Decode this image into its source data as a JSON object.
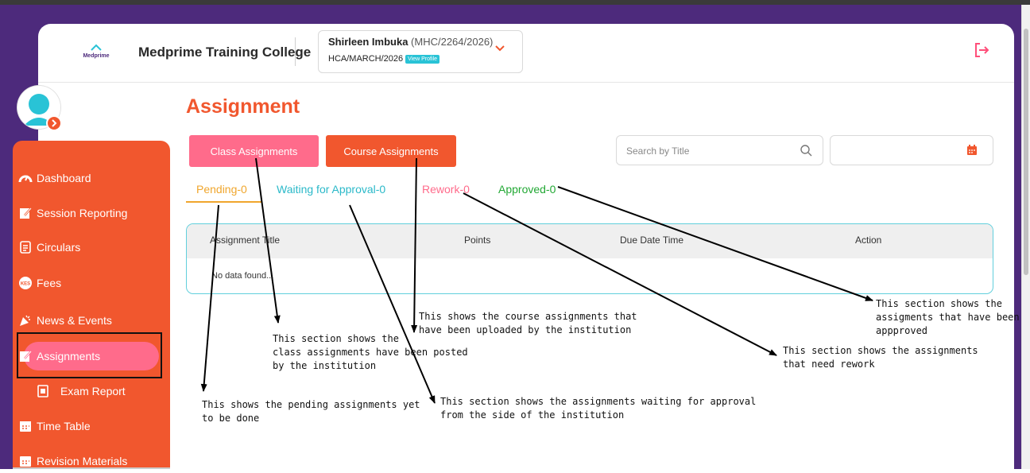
{
  "header": {
    "college_name": "Medprime Training College",
    "logo_text": "Medprime",
    "student_name": "Shirleen Imbuka",
    "student_id": "(MHC/2264/2026)",
    "class_code": "HCA/MARCH/2026",
    "view_profile_label": "View Profile"
  },
  "sidebar": {
    "items": [
      {
        "label": "Dashboard",
        "icon": "dashboard-icon"
      },
      {
        "label": "Session Reporting",
        "icon": "edit-icon"
      },
      {
        "label": "Circulars",
        "icon": "circular-icon"
      },
      {
        "label": "Fees",
        "icon": "fees-icon"
      },
      {
        "label": "News & Events",
        "icon": "party-icon"
      },
      {
        "label": "Assignments",
        "icon": "edit-icon"
      },
      {
        "label": "Exam Report",
        "icon": "report-icon"
      },
      {
        "label": "Time Table",
        "icon": "calendar-icon"
      },
      {
        "label": "Revision Materials",
        "icon": "calendar-icon"
      }
    ],
    "fees_badge": "KES"
  },
  "main": {
    "title": "Assignment",
    "buttons": {
      "class": "Class Assignments",
      "course": "Course Assignments"
    },
    "search_placeholder": "Search by Title",
    "tabs": {
      "pending": "Pending-0",
      "waiting": "Waiting for Approval-0",
      "rework": "Rework-0",
      "approved": "Approved-0"
    },
    "table": {
      "columns": [
        "Assignment Title",
        "Points",
        "Due Date Time",
        "Action"
      ],
      "empty_message": "No data found..."
    }
  },
  "annotations": {
    "class": "This section shows the\nclass assignments have been posted\nby the institution",
    "course": "This shows the course assignments that\nhave been uploaded by the institution",
    "approved": "This section shows the\nassigments that have been\nappproved",
    "rework": "This section shows the assignments\nthat need rework",
    "waiting": "This section shows the assignments waiting for approval\nfrom the side of the institution",
    "pending": "This shows the pending assignments yet\nto be done"
  },
  "colors": {
    "accent": "#f1572e",
    "pink": "#ff6b8b",
    "pending": "#f0a62d",
    "waiting": "#2bb9c9",
    "approved": "#22a834",
    "background": "#4d2a7c"
  }
}
